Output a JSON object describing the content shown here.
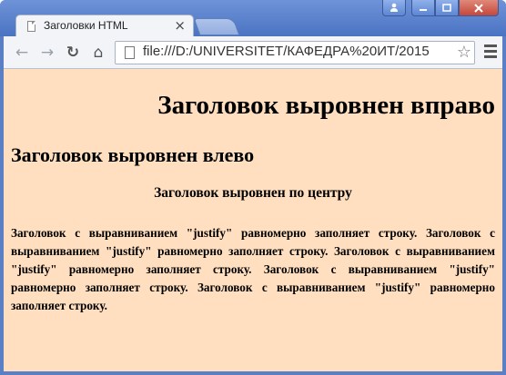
{
  "browser": {
    "tab_title": "Заголовки HTML",
    "tab_close": "×",
    "url": "file:///D:/UNIVERSITET/КАФЕДРА%20ИТ/2015",
    "back_icon": "←",
    "forward_icon": "→",
    "reload_icon": "↻",
    "home_icon": "⌂",
    "star_icon": "☆",
    "window_buttons": {
      "user": "👤",
      "minimize": "▬",
      "maximize": "▭",
      "close": "✕"
    }
  },
  "page": {
    "background": "#ffdfbf",
    "heading_right": "Заголовок выровнен вправо",
    "heading_left": "Заголовок выровнен влево",
    "heading_center": "Заголовок выровнен по центру",
    "heading_justify": "Заголовок с выравниванием \"justify\" равномерно заполняет строку. Заголовок с выравниванием \"justify\" равномерно заполняет строку. Заголовок с выравниванием \"justify\" равномерно заполняет строку. Заголовок с выравниванием \"justify\" равномерно заполняет строку. Заголовок с выравниванием \"justify\" равномерно заполняет строку."
  }
}
